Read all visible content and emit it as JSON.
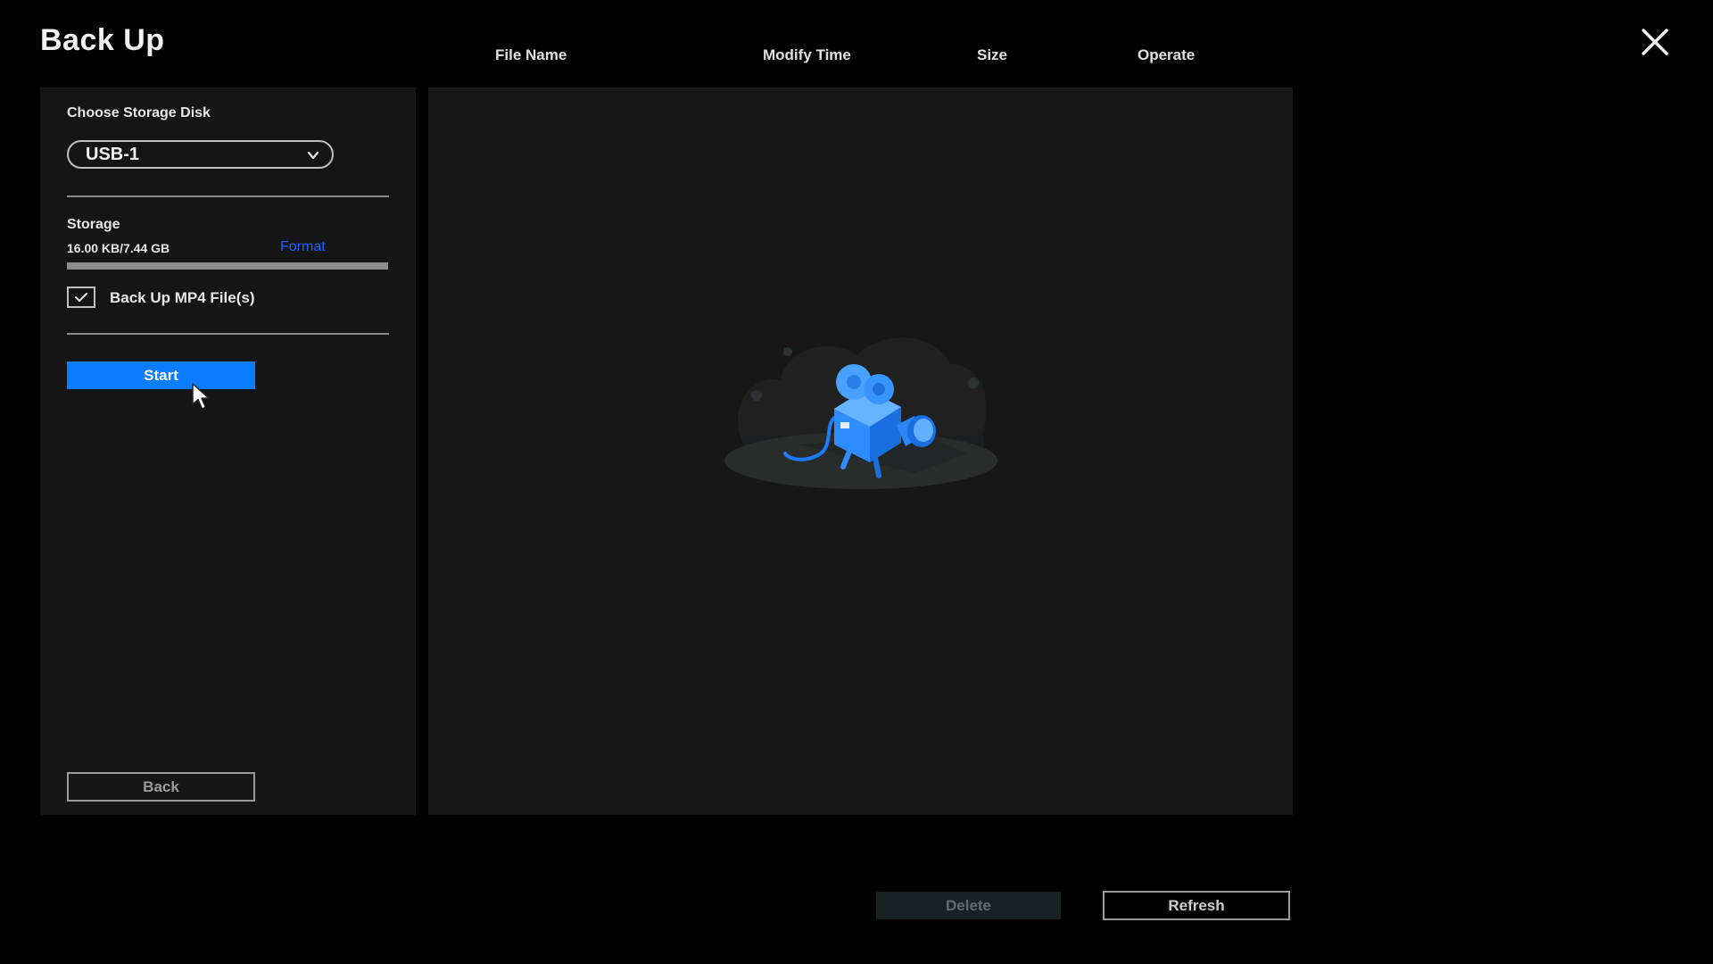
{
  "dialog": {
    "title": "Back Up",
    "close_icon": "close-icon"
  },
  "table": {
    "columns": [
      "File Name",
      "Modify Time",
      "Size",
      "Operate"
    ],
    "rows": []
  },
  "sidebar": {
    "disk_label": "Choose Storage Disk",
    "disk_selected": "USB-1",
    "storage_label": "Storage",
    "storage_usage": "16.00 KB/7.44 GB",
    "storage_used_fraction": 2e-06,
    "format_label": "Format",
    "mp4_checkbox_label": "Back Up MP4 File(s)",
    "mp4_checked": true,
    "start_label": "Start",
    "back_label": "Back"
  },
  "empty_state": {
    "icon": "camera-illustration-icon"
  },
  "footer": {
    "delete_label": "Delete",
    "refresh_label": "Refresh"
  },
  "colors": {
    "accent": "#0a7cff",
    "link": "#1a63ff",
    "background": "#000000",
    "panel": "#151515"
  }
}
